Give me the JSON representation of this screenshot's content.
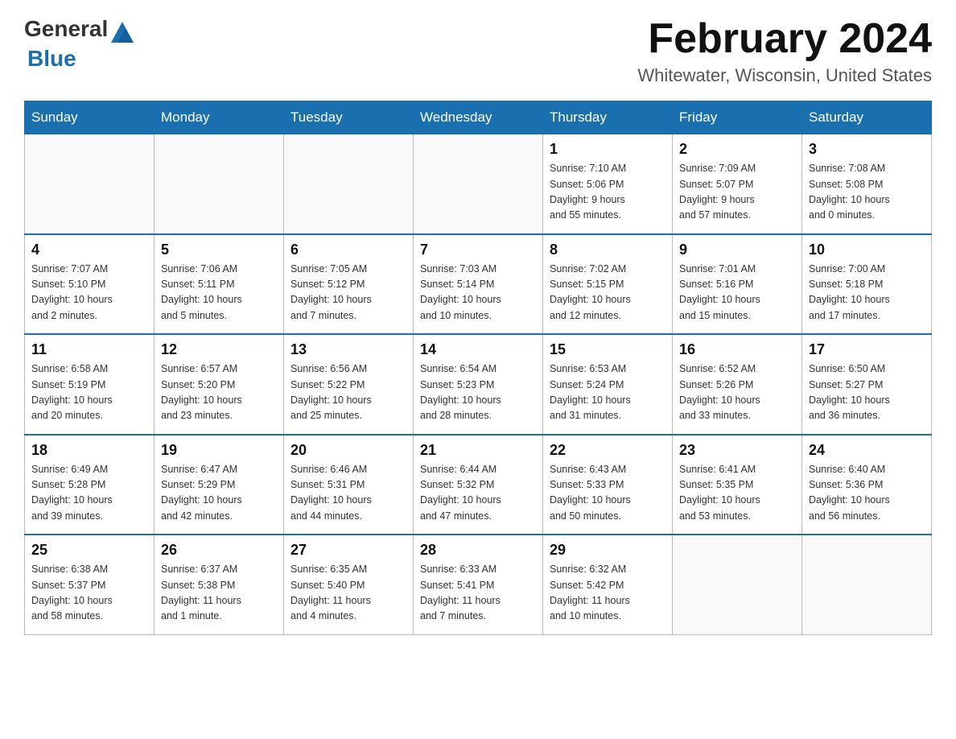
{
  "header": {
    "logo_general": "General",
    "logo_blue": "Blue",
    "month_title": "February 2024",
    "location": "Whitewater, Wisconsin, United States"
  },
  "weekdays": [
    "Sunday",
    "Monday",
    "Tuesday",
    "Wednesday",
    "Thursday",
    "Friday",
    "Saturday"
  ],
  "weeks": [
    [
      {
        "day": "",
        "info": ""
      },
      {
        "day": "",
        "info": ""
      },
      {
        "day": "",
        "info": ""
      },
      {
        "day": "",
        "info": ""
      },
      {
        "day": "1",
        "info": "Sunrise: 7:10 AM\nSunset: 5:06 PM\nDaylight: 9 hours\nand 55 minutes."
      },
      {
        "day": "2",
        "info": "Sunrise: 7:09 AM\nSunset: 5:07 PM\nDaylight: 9 hours\nand 57 minutes."
      },
      {
        "day": "3",
        "info": "Sunrise: 7:08 AM\nSunset: 5:08 PM\nDaylight: 10 hours\nand 0 minutes."
      }
    ],
    [
      {
        "day": "4",
        "info": "Sunrise: 7:07 AM\nSunset: 5:10 PM\nDaylight: 10 hours\nand 2 minutes."
      },
      {
        "day": "5",
        "info": "Sunrise: 7:06 AM\nSunset: 5:11 PM\nDaylight: 10 hours\nand 5 minutes."
      },
      {
        "day": "6",
        "info": "Sunrise: 7:05 AM\nSunset: 5:12 PM\nDaylight: 10 hours\nand 7 minutes."
      },
      {
        "day": "7",
        "info": "Sunrise: 7:03 AM\nSunset: 5:14 PM\nDaylight: 10 hours\nand 10 minutes."
      },
      {
        "day": "8",
        "info": "Sunrise: 7:02 AM\nSunset: 5:15 PM\nDaylight: 10 hours\nand 12 minutes."
      },
      {
        "day": "9",
        "info": "Sunrise: 7:01 AM\nSunset: 5:16 PM\nDaylight: 10 hours\nand 15 minutes."
      },
      {
        "day": "10",
        "info": "Sunrise: 7:00 AM\nSunset: 5:18 PM\nDaylight: 10 hours\nand 17 minutes."
      }
    ],
    [
      {
        "day": "11",
        "info": "Sunrise: 6:58 AM\nSunset: 5:19 PM\nDaylight: 10 hours\nand 20 minutes."
      },
      {
        "day": "12",
        "info": "Sunrise: 6:57 AM\nSunset: 5:20 PM\nDaylight: 10 hours\nand 23 minutes."
      },
      {
        "day": "13",
        "info": "Sunrise: 6:56 AM\nSunset: 5:22 PM\nDaylight: 10 hours\nand 25 minutes."
      },
      {
        "day": "14",
        "info": "Sunrise: 6:54 AM\nSunset: 5:23 PM\nDaylight: 10 hours\nand 28 minutes."
      },
      {
        "day": "15",
        "info": "Sunrise: 6:53 AM\nSunset: 5:24 PM\nDaylight: 10 hours\nand 31 minutes."
      },
      {
        "day": "16",
        "info": "Sunrise: 6:52 AM\nSunset: 5:26 PM\nDaylight: 10 hours\nand 33 minutes."
      },
      {
        "day": "17",
        "info": "Sunrise: 6:50 AM\nSunset: 5:27 PM\nDaylight: 10 hours\nand 36 minutes."
      }
    ],
    [
      {
        "day": "18",
        "info": "Sunrise: 6:49 AM\nSunset: 5:28 PM\nDaylight: 10 hours\nand 39 minutes."
      },
      {
        "day": "19",
        "info": "Sunrise: 6:47 AM\nSunset: 5:29 PM\nDaylight: 10 hours\nand 42 minutes."
      },
      {
        "day": "20",
        "info": "Sunrise: 6:46 AM\nSunset: 5:31 PM\nDaylight: 10 hours\nand 44 minutes."
      },
      {
        "day": "21",
        "info": "Sunrise: 6:44 AM\nSunset: 5:32 PM\nDaylight: 10 hours\nand 47 minutes."
      },
      {
        "day": "22",
        "info": "Sunrise: 6:43 AM\nSunset: 5:33 PM\nDaylight: 10 hours\nand 50 minutes."
      },
      {
        "day": "23",
        "info": "Sunrise: 6:41 AM\nSunset: 5:35 PM\nDaylight: 10 hours\nand 53 minutes."
      },
      {
        "day": "24",
        "info": "Sunrise: 6:40 AM\nSunset: 5:36 PM\nDaylight: 10 hours\nand 56 minutes."
      }
    ],
    [
      {
        "day": "25",
        "info": "Sunrise: 6:38 AM\nSunset: 5:37 PM\nDaylight: 10 hours\nand 58 minutes."
      },
      {
        "day": "26",
        "info": "Sunrise: 6:37 AM\nSunset: 5:38 PM\nDaylight: 11 hours\nand 1 minute."
      },
      {
        "day": "27",
        "info": "Sunrise: 6:35 AM\nSunset: 5:40 PM\nDaylight: 11 hours\nand 4 minutes."
      },
      {
        "day": "28",
        "info": "Sunrise: 6:33 AM\nSunset: 5:41 PM\nDaylight: 11 hours\nand 7 minutes."
      },
      {
        "day": "29",
        "info": "Sunrise: 6:32 AM\nSunset: 5:42 PM\nDaylight: 11 hours\nand 10 minutes."
      },
      {
        "day": "",
        "info": ""
      },
      {
        "day": "",
        "info": ""
      }
    ]
  ]
}
